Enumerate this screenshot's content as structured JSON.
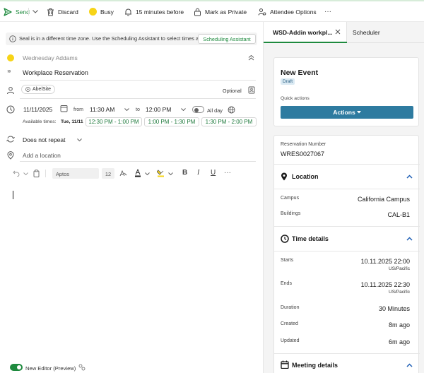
{
  "toolbar": {
    "send": "Send",
    "discard": "Discard",
    "busy": "Busy",
    "reminder": "15 minutes before",
    "mark_private": "Mark as Private",
    "attendee_options": "Attendee Options",
    "more": "···"
  },
  "compose": {
    "infobar_text": "Seal is in a different time zone. Use the Scheduling Assistant to select times a...",
    "scheduling_assistant": "Scheduling Assistant",
    "organizer": "Wednesday Addams",
    "title": "Workplace Reservation",
    "attendee_chip": "AbelSite",
    "optional": "Optional",
    "date": "11/11/2025",
    "from_label": "from",
    "start_time": "11:30 AM",
    "to_label": "to",
    "end_time": "12:00 PM",
    "all_day": "All day",
    "available_label": "Available times:",
    "available_day": "Tue, 11/11",
    "slots": [
      "12:30 PM - 1:00 PM",
      "1:00 PM - 1:30 PM",
      "1:30 PM - 2:00 PM"
    ],
    "repeat": "Does not repeat",
    "location_placeholder": "Add a location",
    "font_name": "Aptos",
    "font_size": "12",
    "new_editor": "New Editor (Preview)"
  },
  "tabs": {
    "addin": "WSD-Addin workpl...",
    "scheduler": "Scheduler"
  },
  "panel": {
    "event_title": "New Event",
    "status_badge": "Draft",
    "quick_actions_label": "Quick actions",
    "actions_button": "Actions",
    "reservation_number_label": "Reservation Number",
    "reservation_number": "WRES0027067",
    "location": {
      "title": "Location",
      "campus_label": "Campus",
      "campus": "California Campus",
      "buildings_label": "Buildings",
      "building": "CAL-B1"
    },
    "time": {
      "title": "Time details",
      "starts_label": "Starts",
      "starts": "10.11.2025 22:00",
      "starts_tz": "US/Pacific",
      "ends_label": "Ends",
      "ends": "10.11.2025 22:30",
      "ends_tz": "US/Pacific",
      "duration_label": "Duration",
      "duration": "30 Minutes",
      "created_label": "Created",
      "created": "8m ago",
      "updated_label": "Updated",
      "updated": "6m ago"
    },
    "meeting": {
      "title": "Meeting details"
    }
  },
  "colors": {
    "green": "#1e8a3e",
    "busy_yellow": "#f7d417",
    "actions_blue": "#2e7ba0",
    "chevron_blue": "#1f5fb5"
  }
}
